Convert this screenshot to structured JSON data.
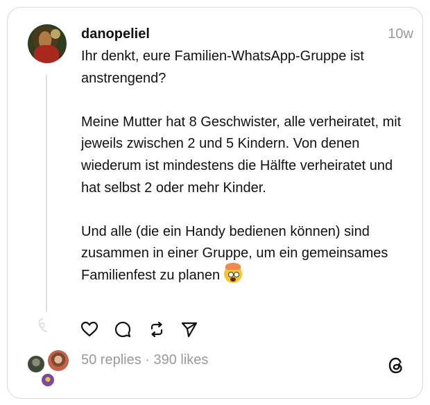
{
  "post": {
    "username": "danopeliel",
    "timestamp": "10w",
    "paragraphs": [
      "Ihr denkt, eure Familien-WhatsApp-Gruppe ist anstrengend?",
      "Meine Mutter hat 8 Geschwister, alle verheiratet, mit jeweils zwischen 2 und 5 Kindern. Von denen wiederum ist mindestens die Hälfte verheiratet und hat selbst 2 oder mehr Kinder.",
      "Und alle (die ein Handy bedienen können) sind zusammen in einer Gruppe, um ein gemeinsames Familienfest zu planen"
    ],
    "emoji": "exploding-head-emoji"
  },
  "actions": [
    {
      "icon": "heart-icon"
    },
    {
      "icon": "comment-icon"
    },
    {
      "icon": "repost-icon"
    },
    {
      "icon": "share-icon"
    }
  ],
  "stats": "50 replies · 390 likes",
  "colors": {
    "text": "#111111",
    "muted": "#9a9a9a",
    "border": "#d9d9d9"
  }
}
